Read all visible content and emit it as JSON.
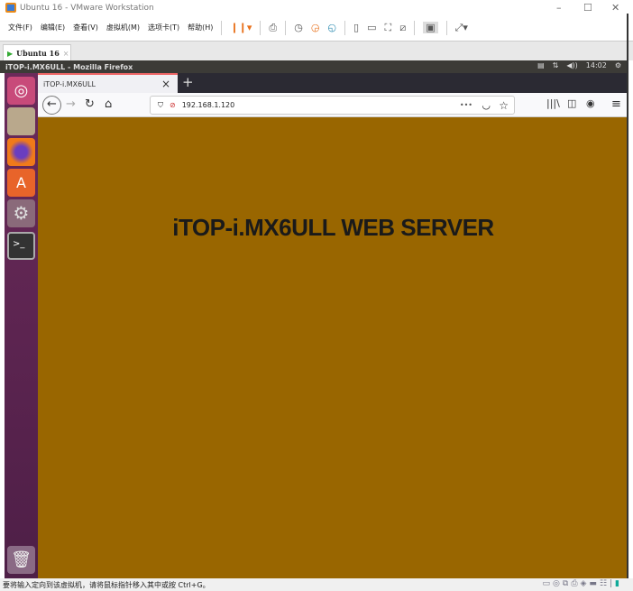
{
  "window": {
    "title": "Ubuntu 16 - VMware Workstation",
    "minimize": "–",
    "maximize": "☐",
    "close": "✕"
  },
  "menu": [
    "文件(F)",
    "编辑(E)",
    "查看(V)",
    "虚拟机(M)",
    "选项卡(T)",
    "帮助(H)"
  ],
  "vm_tab": {
    "label": "Ubuntu 16",
    "close": "×"
  },
  "panel": {
    "title": "iTOP-i.MX6ULL - Mozilla Firefox",
    "time": "14:02"
  },
  "firefox": {
    "tab_title": "iTOP-i.MX6ULL",
    "tab_close": "×",
    "new_tab": "+",
    "url": "192.168.1.120",
    "more": "•••"
  },
  "page": {
    "heading": "iTOP-i.MX6ULL WEB SERVER"
  },
  "status": {
    "text": "要将输入定向到该虚拟机，请将鼠标指针移入其中或按 Ctrl+G。"
  },
  "colors": {
    "content_bg": "#996600",
    "launcher": "#5e2750"
  }
}
